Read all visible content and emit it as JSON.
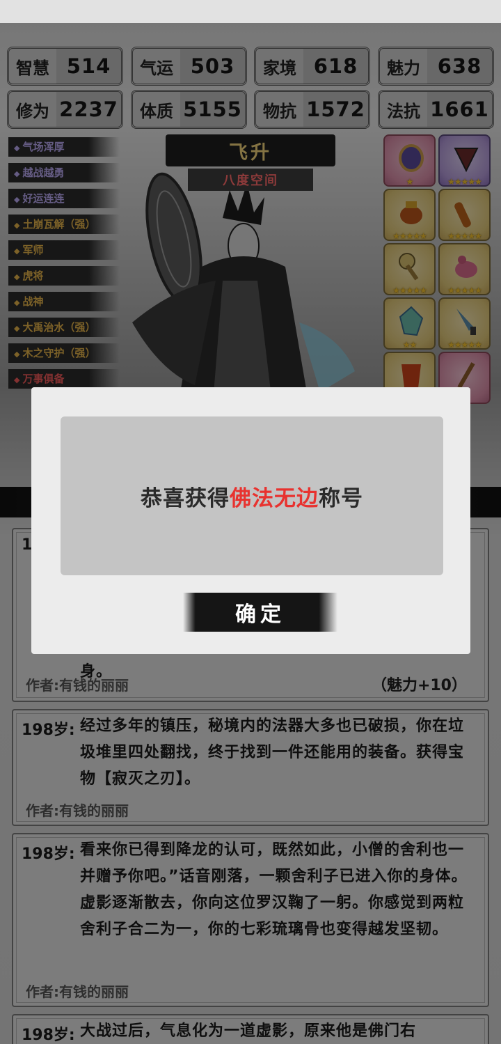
{
  "stats": [
    {
      "label": "智慧",
      "value": "514"
    },
    {
      "label": "气运",
      "value": "503"
    },
    {
      "label": "家境",
      "value": "618"
    },
    {
      "label": "魅力",
      "value": "638"
    },
    {
      "label": "修为",
      "value": "2237"
    },
    {
      "label": "体质",
      "value": "5155"
    },
    {
      "label": "物抗",
      "value": "1572"
    },
    {
      "label": "法抗",
      "value": "1661"
    }
  ],
  "realm": {
    "title": "飞升",
    "subtitle": "八度空间"
  },
  "traits": [
    {
      "label": "气场浑厚",
      "tone": "purple"
    },
    {
      "label": "越战越勇",
      "tone": "purple"
    },
    {
      "label": "好运连连",
      "tone": "purple"
    },
    {
      "label": "土崩瓦解（强）",
      "tone": "gold"
    },
    {
      "label": "军师",
      "tone": "gold"
    },
    {
      "label": "虎将",
      "tone": "gold"
    },
    {
      "label": "战神",
      "tone": "gold"
    },
    {
      "label": "大禹治水（强）",
      "tone": "gold"
    },
    {
      "label": "木之守护（强）",
      "tone": "gold"
    },
    {
      "label": "万事俱备",
      "tone": "red"
    }
  ],
  "items": [
    {
      "name": "mirror",
      "tone": "pink",
      "stars": 1
    },
    {
      "name": "fan",
      "tone": "purple",
      "stars": 5
    },
    {
      "name": "cauldron",
      "tone": "gold",
      "stars": 5
    },
    {
      "name": "scroll",
      "tone": "gold",
      "stars": 5
    },
    {
      "name": "rattle",
      "tone": "gold",
      "stars": 5
    },
    {
      "name": "bird",
      "tone": "gold",
      "stars": 5
    },
    {
      "name": "crystal",
      "tone": "gold",
      "stars": 2
    },
    {
      "name": "dagger",
      "tone": "gold",
      "stars": 5
    },
    {
      "name": "armor",
      "tone": "gold",
      "stars": 0
    },
    {
      "name": "sword",
      "tone": "pink",
      "stars": 0
    }
  ],
  "logs": [
    {
      "age": "19",
      "text": "",
      "tail": "身。",
      "author": "作者:有钱的丽丽",
      "bonus": "（魅力+10）"
    },
    {
      "age": "198岁:",
      "text": "经过多年的镇压，秘境内的法器大多也已破损，你在垃圾堆里四处翻找，终于找到一件还能用的装备。获得宝物【寂灭之刃】。",
      "author": "作者:有钱的丽丽",
      "bonus": ""
    },
    {
      "age": "198岁:",
      "text": "看来你已得到降龙的认可，既然如此，小僧的舍利也一并赠予你吧。”话音刚落，一颗舍利子已进入你的身体。虚影逐渐散去，你向这位罗汉鞠了一躬。你感觉到两粒舍利子合二为一，你的七彩琉璃骨也变得越发坚韧。",
      "author": "作者:有钱的丽丽",
      "bonus": ""
    },
    {
      "age": "198岁:",
      "text": "大战过后，气息化为一道虚影，原来他是佛门右",
      "author": "",
      "bonus": ""
    }
  ],
  "dialog": {
    "prefix": "恭喜获得",
    "highlight": "佛法无边",
    "suffix": "称号",
    "confirm": "确定"
  },
  "colors": {
    "highlight": "#e8322f",
    "realm_title": "#f0d27a",
    "realm_sub": "#ff6b6b"
  }
}
